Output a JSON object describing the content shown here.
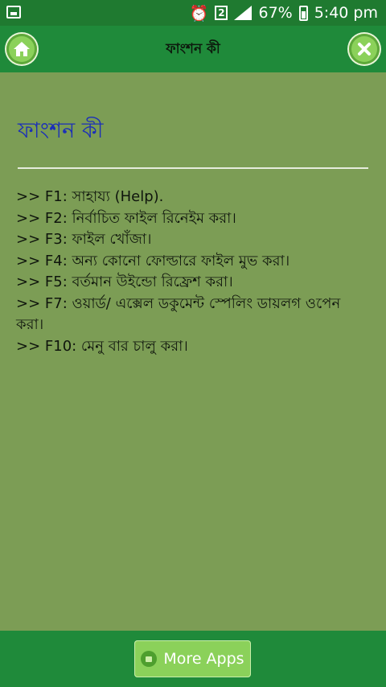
{
  "status_bar": {
    "sim_label": "2",
    "battery_percent": "67%",
    "time": "5:40 pm",
    "icons": [
      "image-icon",
      "alarm-icon",
      "sim-icon",
      "signal-icon",
      "battery-icon"
    ]
  },
  "app_bar": {
    "title": "ফাংশন কী",
    "home_icon": "home-icon",
    "close_icon": "close-icon"
  },
  "content": {
    "heading": "ফাংশন কী",
    "lines": [
      ">> F1: সাহায্য (Help).",
      ">> F2: নির্বাচিত ফাইল রিনেইম করা।",
      ">> F3: ফাইল খোঁজা।",
      ">> F4: অন্য কোনো ফোল্ডারে ফাইল মুভ করা।",
      ">> F5: বর্তমান উইন্ডো রিফ্রেশ করা।",
      ">> F7: ওয়ার্ড/ এক্সেল ডকুমেন্ট স্পেলিং ডায়লগ ওপেন করা।",
      ">> F10: মেনু বার চালু করা।"
    ]
  },
  "bottom_bar": {
    "more_apps_label": "More Apps"
  },
  "colors": {
    "status_bar": "#1f7a30",
    "app_bar": "#1f8a3a",
    "background": "#7c9d55",
    "heading": "#1b2fb8",
    "button": "#8bd15a"
  }
}
